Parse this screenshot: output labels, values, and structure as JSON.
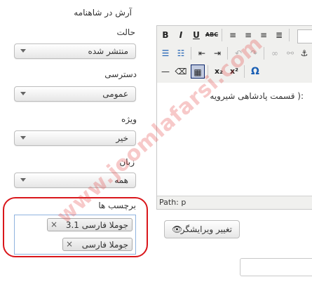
{
  "sidebar": {
    "crumb": "آرش در شاهنامه",
    "fields": [
      {
        "label": "حالت",
        "value": "منتشر شده"
      },
      {
        "label": "دسترسی",
        "value": "عمومی"
      },
      {
        "label": "ویژه",
        "value": "خیر"
      },
      {
        "label": "زبان",
        "value": "همه"
      }
    ],
    "tags": {
      "label": "برچسب ها",
      "items": [
        "جوملا فارسی 3.1",
        "جوملا فارسی"
      ],
      "remove_glyph": "×"
    }
  },
  "editor": {
    "toolbar": {
      "bold": "B",
      "italic": "I",
      "underline": "U",
      "strike": "ABC",
      "sub": "x₂",
      "sup": "x²",
      "omega": "Ω"
    },
    "content_text": "قسمت پادشاهی شیرویه ):",
    "path_label": "Path: p",
    "toggle_label": "تغییر ویرایشگر"
  },
  "watermark": "www.joomlafarsi.com"
}
